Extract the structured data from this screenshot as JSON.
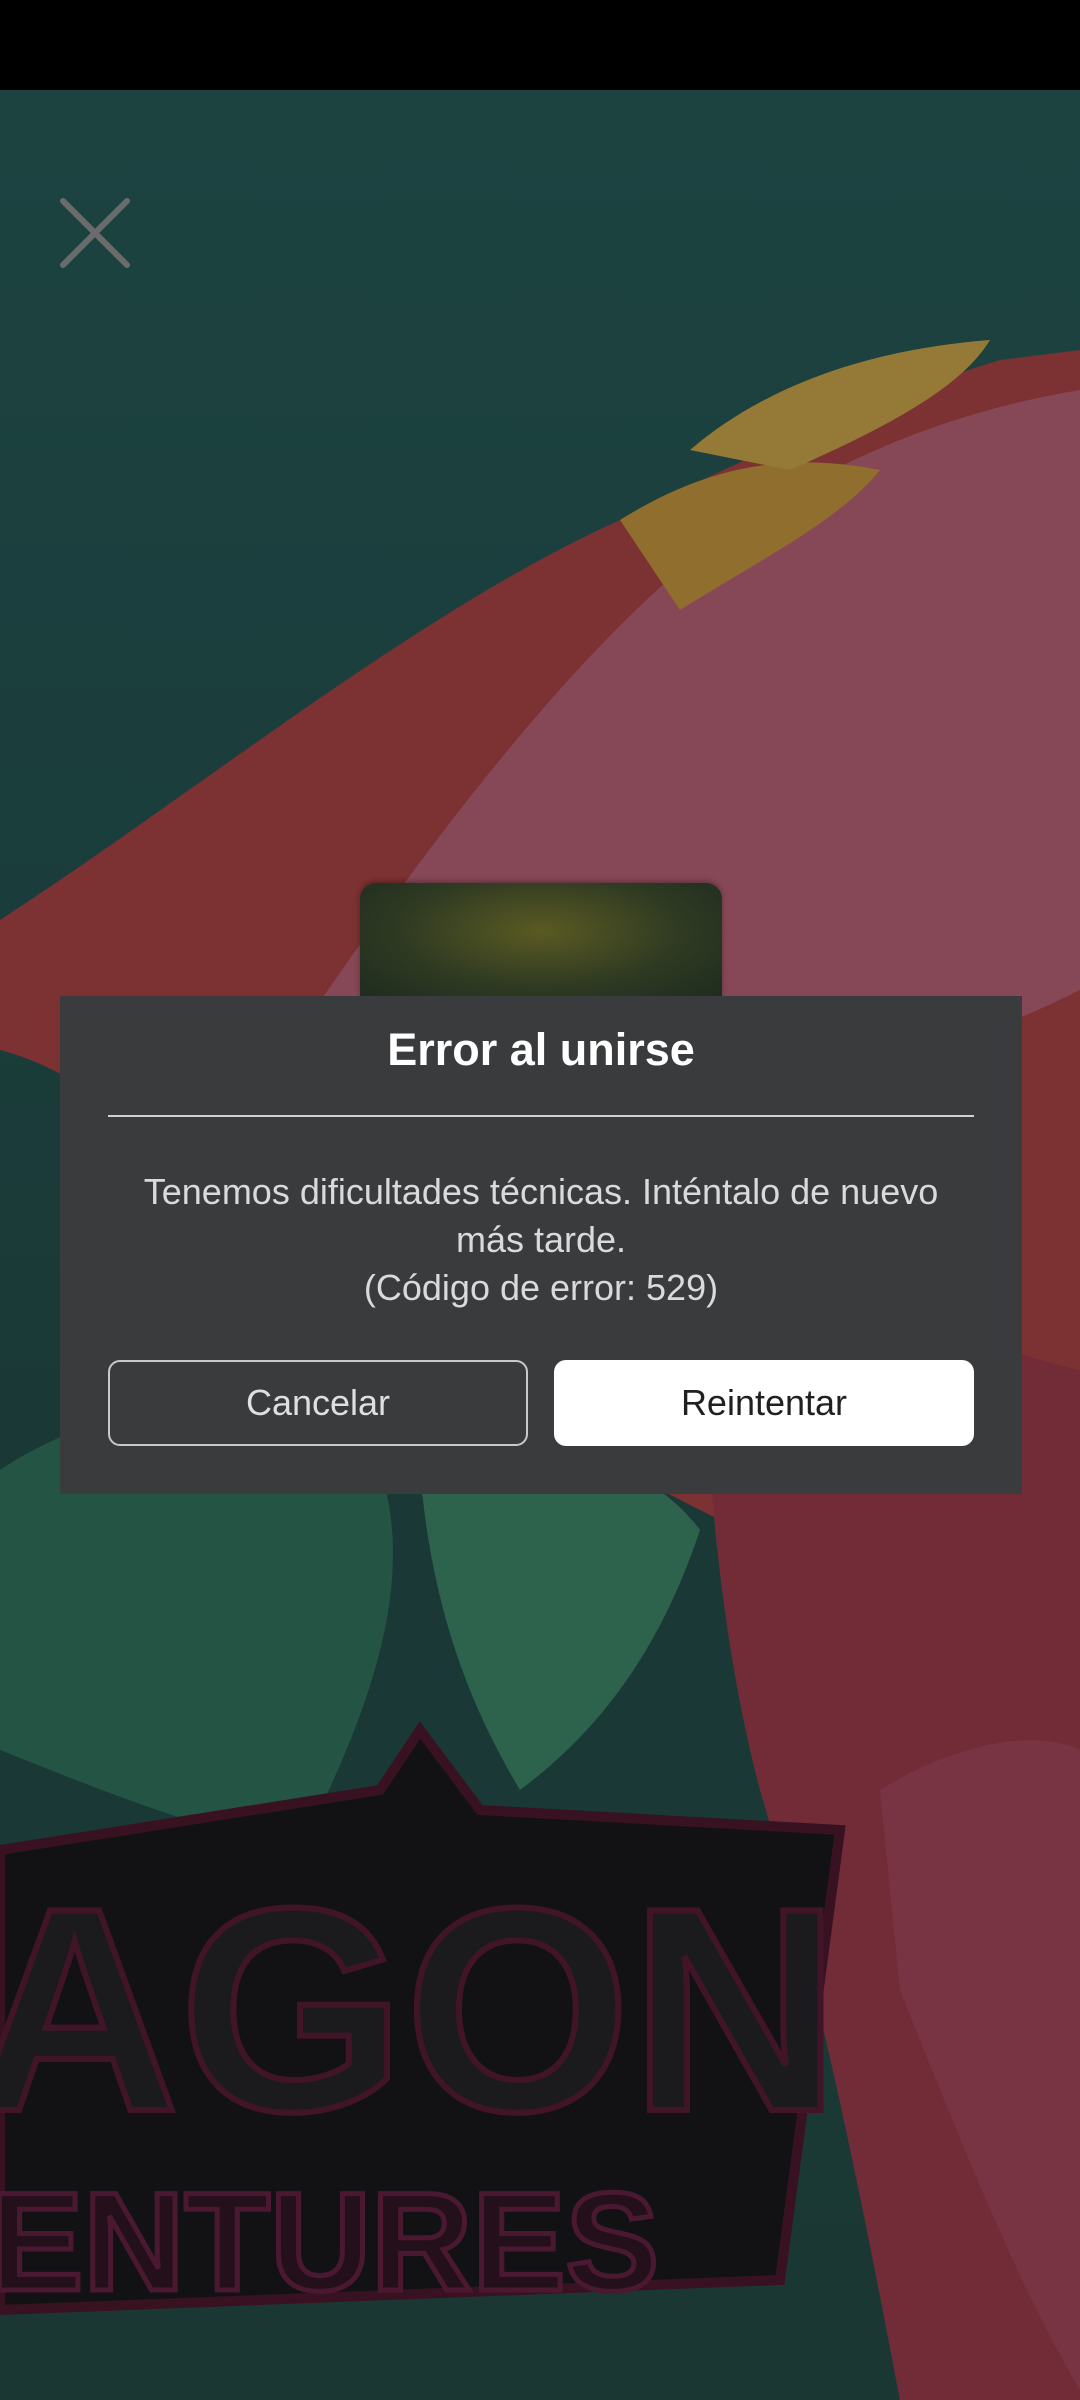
{
  "dialog": {
    "title": "Error al unirse",
    "message_line1": "Tenemos dificultades técnicas. Inténtalo de nuevo más tarde.",
    "message_line2": "(Código de error: 529)",
    "cancel_label": "Cancelar",
    "retry_label": "Reintentar"
  },
  "icons": {
    "close": "close-icon"
  },
  "background": {
    "game_logo_text_line1": "AGON",
    "game_logo_text_line2": "ENTURES"
  },
  "colors": {
    "dialog_bg": "#393b3d",
    "retry_button_bg": "#ffffff",
    "background_teal": "#2b6360"
  }
}
